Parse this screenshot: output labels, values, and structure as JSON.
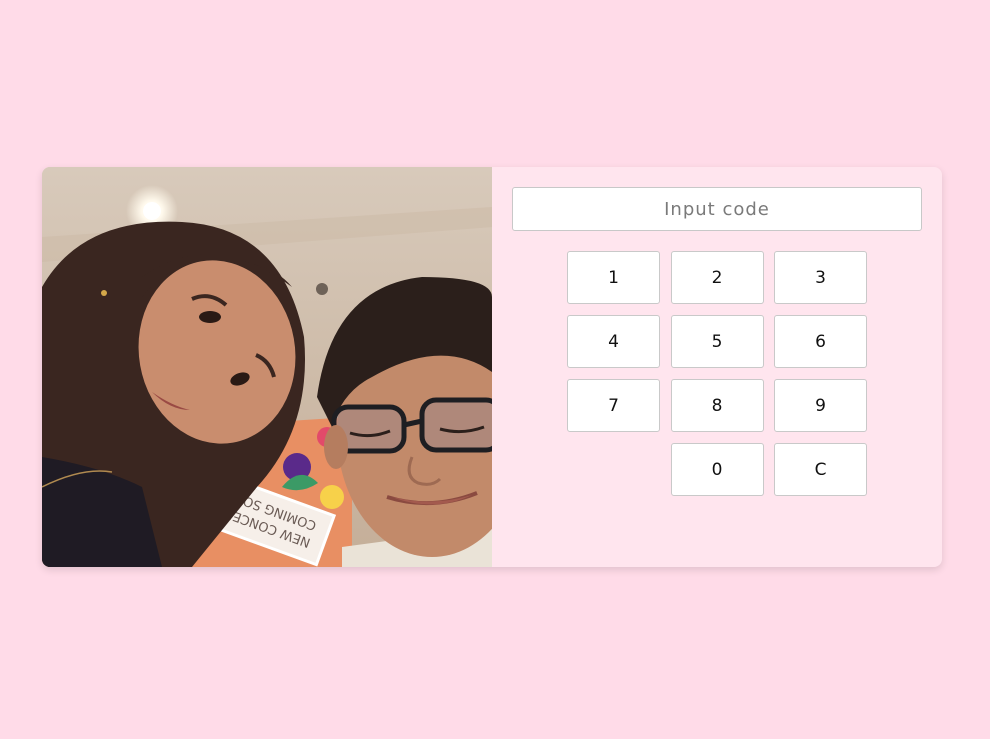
{
  "photo": {
    "alt": "Selfie of two people in front of a floral sign",
    "sign_line1": "NEW CONCEPT",
    "sign_line2": "COMING SOON"
  },
  "code_input": {
    "placeholder": "Input code",
    "value": ""
  },
  "keypad": {
    "keys": [
      "1",
      "2",
      "3",
      "4",
      "5",
      "6",
      "7",
      "8",
      "9",
      "",
      "0",
      "C"
    ]
  }
}
